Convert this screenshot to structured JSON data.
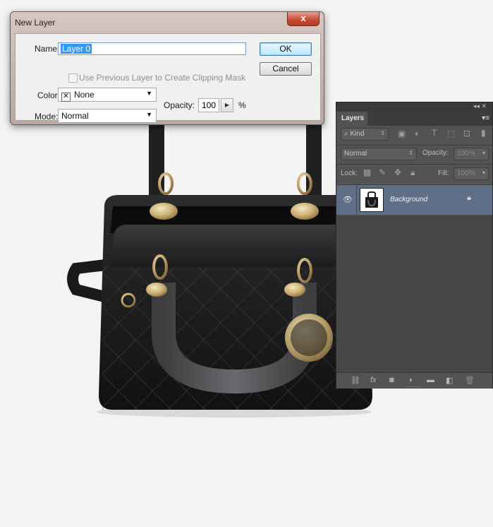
{
  "dialog": {
    "title": "New Layer",
    "close_glyph": "x",
    "name_label": "Name:",
    "name_value": "Layer 0",
    "clip_label": "Use Previous Layer to Create Clipping Mask",
    "color_label": "Color:",
    "color_value": "None",
    "mode_label": "Mode:",
    "mode_value": "Normal",
    "opacity_label": "Opacity:",
    "opacity_value": "100",
    "opacity_unit": "%",
    "ok_label": "OK",
    "cancel_label": "Cancel"
  },
  "layers_panel": {
    "tab_label": "Layers",
    "filter_value": "Kind",
    "blend_mode": "Normal",
    "opacity_label": "Opacity:",
    "opacity_value": "100%",
    "lock_label": "Lock:",
    "fill_label": "Fill:",
    "fill_value": "100%",
    "layers": [
      {
        "name": "Background",
        "visible": true,
        "locked": true,
        "selected": true
      }
    ],
    "filter_icons": [
      "pixel-filter-icon",
      "adjustment-filter-icon",
      "type-filter-icon",
      "shape-filter-icon",
      "smart-object-filter-icon"
    ],
    "lock_icons": [
      "lock-transparent-icon",
      "lock-image-icon",
      "lock-position-icon",
      "lock-all-icon"
    ],
    "bottom_icons": [
      "link-icon",
      "fx-icon",
      "mask-icon",
      "adjustment-icon",
      "folder-icon",
      "new-layer-icon",
      "trash-icon"
    ]
  },
  "colors": {
    "selected_layer": "#5d6e86",
    "panel_bg": "#535353",
    "dialog_frame": "#c8b6b0",
    "canvas_bg": "#f3f3f4"
  }
}
